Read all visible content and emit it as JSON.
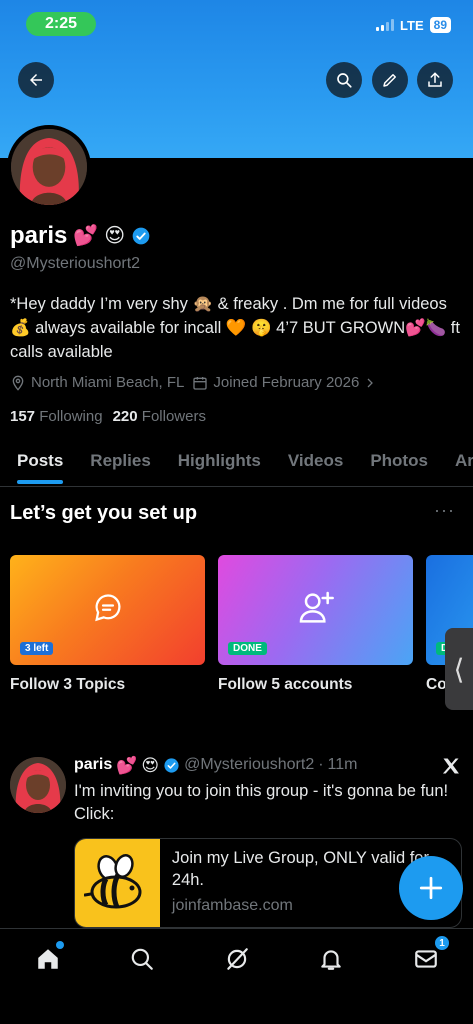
{
  "status_bar": {
    "time": "2:25",
    "network": "LTE",
    "battery": "89"
  },
  "header": {
    "back_icon": "arrow-left-icon",
    "search_icon": "search-icon",
    "edit_icon": "pencil-icon",
    "share_icon": "share-upload-icon",
    "banner_color": "#2a9af0"
  },
  "profile": {
    "name": "paris",
    "name_emojis": [
      "💕",
      "😍"
    ],
    "handle": "@Mysterioushort2",
    "bio": "*Hey daddy I’m very shy 🙊 & freaky . Dm me for full videos 💰 always available for incall 🧡 🤫 4’7 BUT GROWN💕🍆 ft calls available",
    "location": "North Miami Beach, FL",
    "joined": "Joined February 2026",
    "following_count": "157",
    "following_label": "Following",
    "followers_count": "220",
    "followers_label": "Followers"
  },
  "tabs": [
    {
      "label": "Posts",
      "active": true
    },
    {
      "label": "Replies"
    },
    {
      "label": "Highlights"
    },
    {
      "label": "Videos"
    },
    {
      "label": "Photos"
    },
    {
      "label": "Art"
    }
  ],
  "setup": {
    "title": "Let’s get you set up",
    "more": "···",
    "cards": [
      {
        "label": "Follow 3 Topics",
        "badge": "3 left",
        "icon": "topics-chat-icon"
      },
      {
        "label": "Follow 5 accounts",
        "badge": "DONE",
        "icon": "add-user-icon"
      },
      {
        "label": "Co",
        "badge": "D"
      }
    ]
  },
  "side_handle": "⟨",
  "post": {
    "name": "paris",
    "name_emojis": [
      "💕",
      "😍"
    ],
    "handle": "@Mysterioushort2",
    "separator": "·",
    "time": "11m",
    "text": "I'm inviting you to join this group - it's gonna be fun! Click:",
    "link_title": "Join my Live Group, ONLY valid for 24h.",
    "link_domain": "joinfambase.com",
    "link_thumb_icon": "bee-icon"
  },
  "compose": {
    "icon": "plus-icon",
    "color": "#1d9bf0"
  },
  "bottom_nav": {
    "items": [
      "home-icon",
      "search-icon",
      "grok-icon",
      "bell-icon",
      "mail-icon"
    ],
    "mail_badge": "1"
  },
  "colors": {
    "accent": "#1d9bf0",
    "muted": "#71767b",
    "text": "#e7e9ea",
    "done": "#00ba7c"
  }
}
